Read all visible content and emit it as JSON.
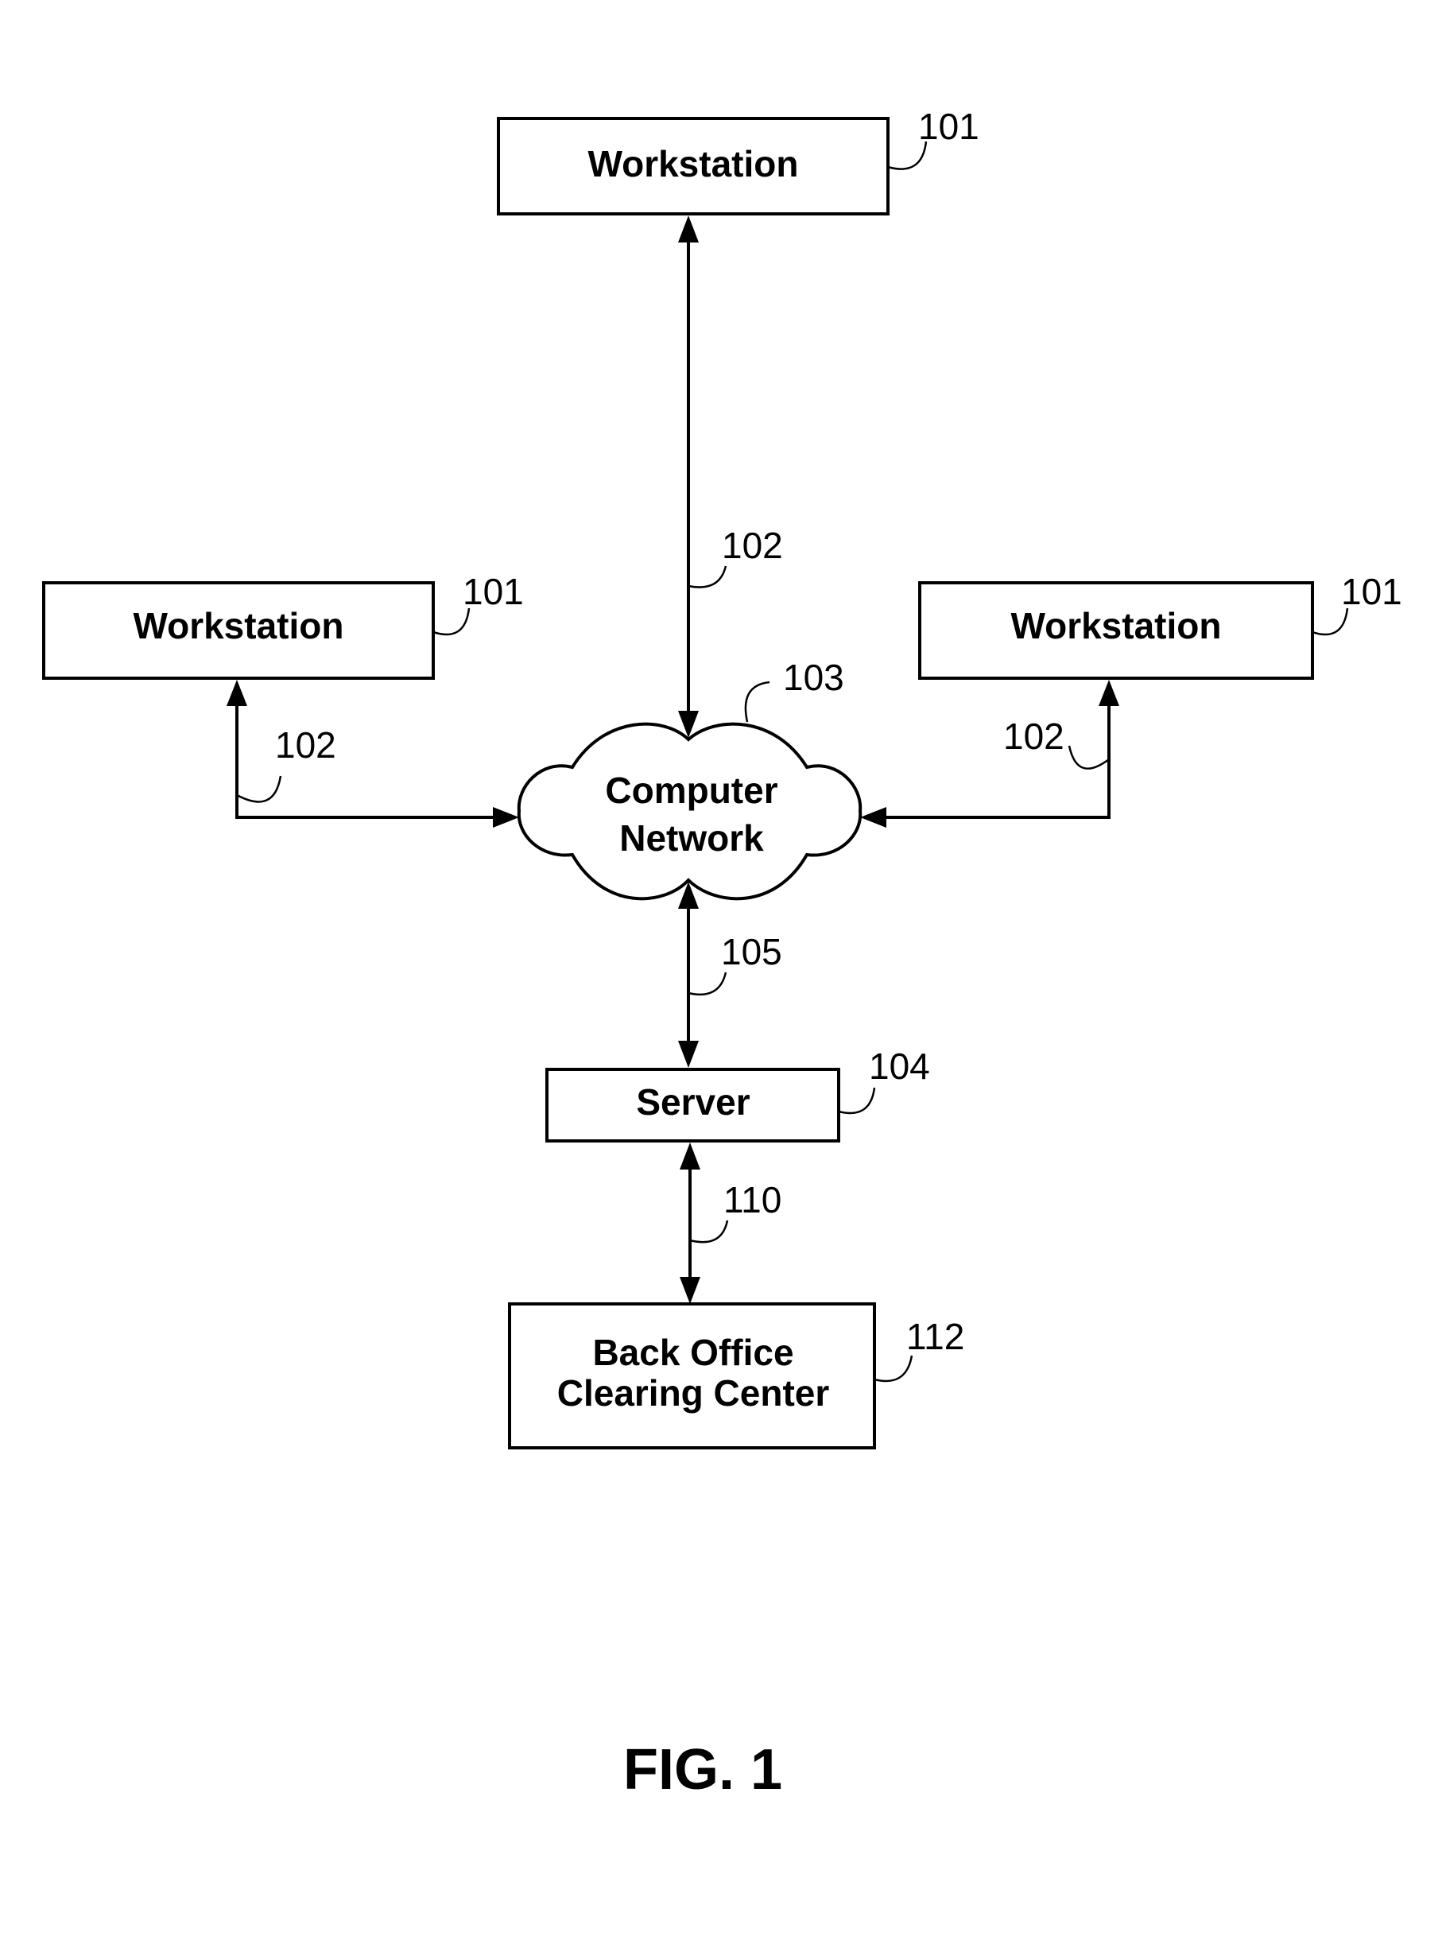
{
  "figure_label": "FIG. 1",
  "nodes": {
    "workstation_top": {
      "label": "Workstation",
      "ref": "101"
    },
    "workstation_left": {
      "label": "Workstation",
      "ref": "101"
    },
    "workstation_right": {
      "label": "Workstation",
      "ref": "101"
    },
    "network": {
      "label_line1": "Computer",
      "label_line2": "Network",
      "ref": "103"
    },
    "server": {
      "label": "Server",
      "ref": "104"
    },
    "back_office": {
      "label_line1": "Back Office",
      "label_line2": "Clearing Center",
      "ref": "112"
    }
  },
  "connections": {
    "top_link": {
      "ref": "102",
      "from": "Workstation",
      "to": "Computer Network",
      "direction": "bidirectional"
    },
    "left_link": {
      "ref": "102",
      "from": "Workstation",
      "to": "Computer Network",
      "direction": "bidirectional"
    },
    "right_link": {
      "ref": "102",
      "from": "Workstation",
      "to": "Computer Network",
      "direction": "bidirectional"
    },
    "network_server_link": {
      "ref": "105",
      "from": "Computer Network",
      "to": "Server",
      "direction": "bidirectional"
    },
    "server_backoffice_link": {
      "ref": "110",
      "from": "Server",
      "to": "Back Office Clearing Center",
      "direction": "bidirectional"
    }
  }
}
